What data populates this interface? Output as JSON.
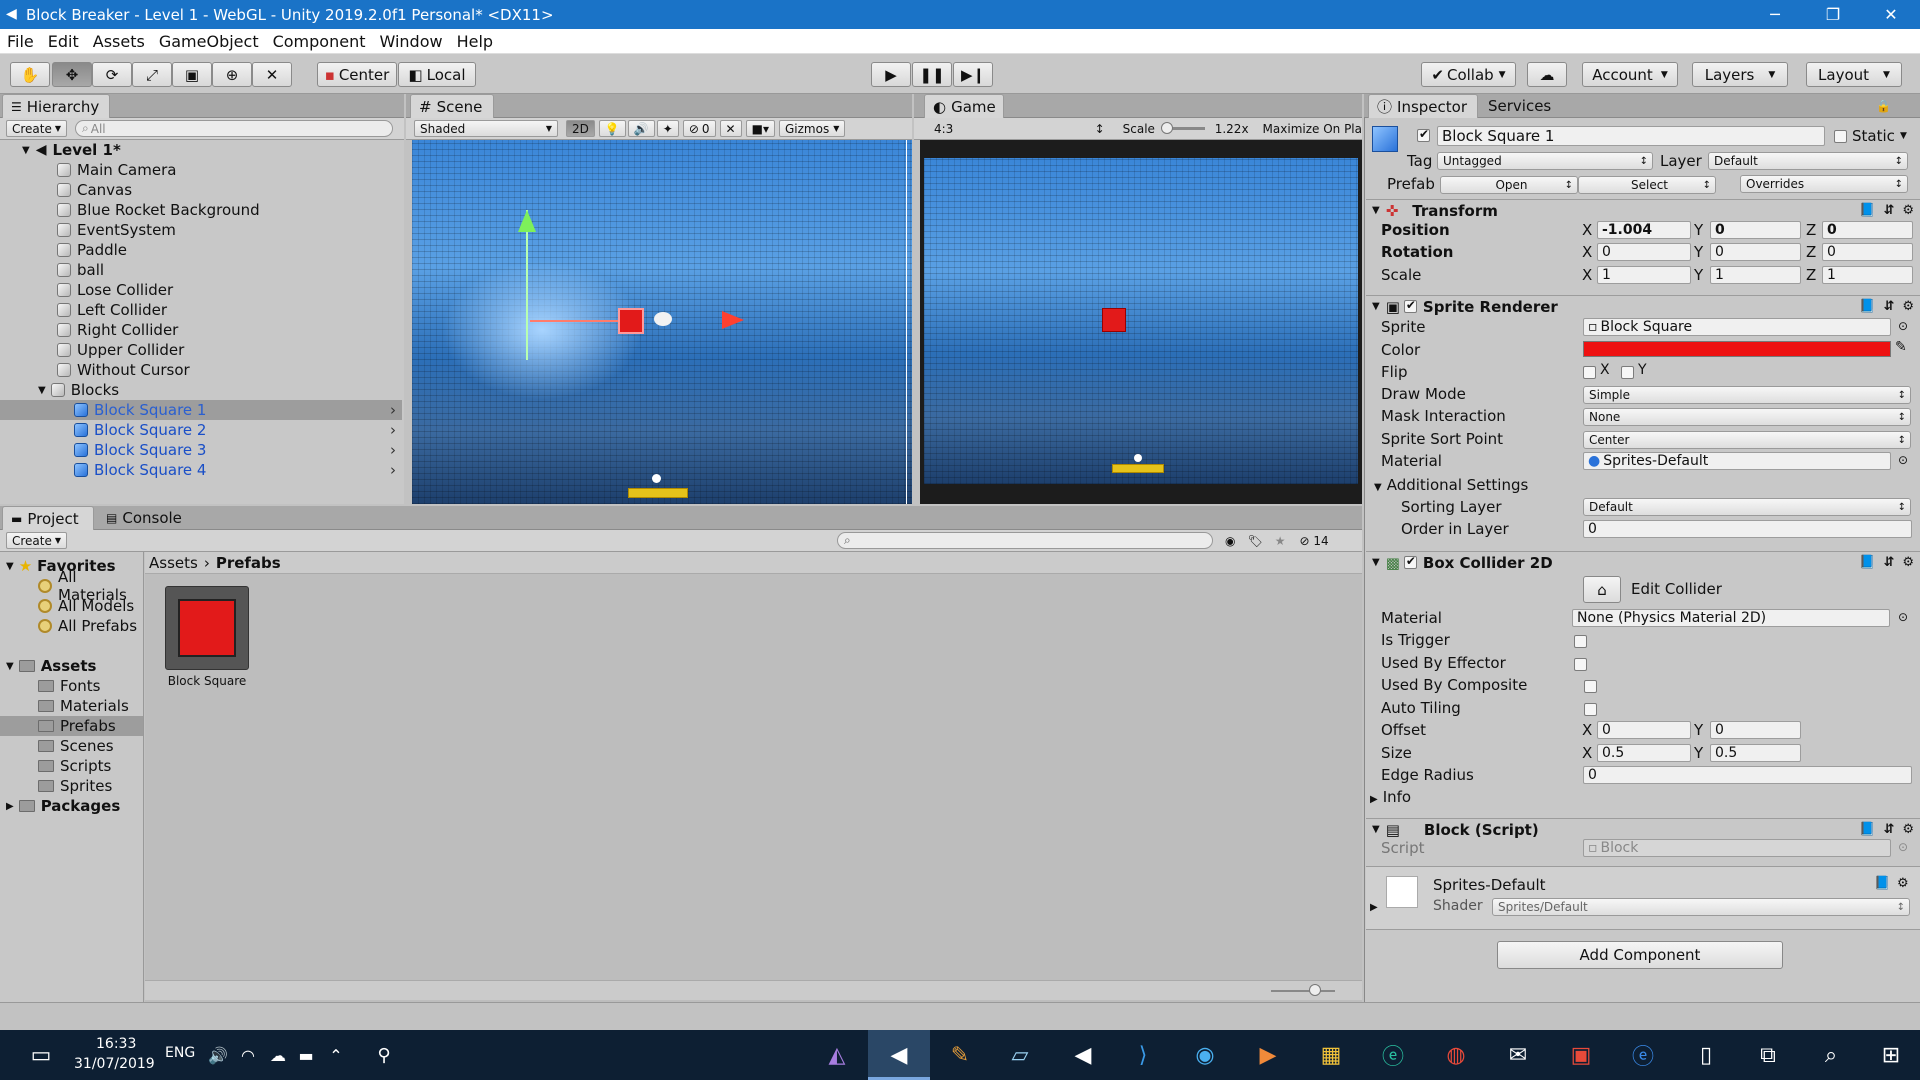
{
  "window": {
    "title": "Block Breaker - Level 1 - WebGL - Unity 2019.2.0f1 Personal* <DX11>",
    "minimize": "─",
    "restore": "❐",
    "close": "✕"
  },
  "menu": [
    "File",
    "Edit",
    "Assets",
    "GameObject",
    "Component",
    "Window",
    "Help"
  ],
  "toolbar": {
    "pivot": "Center",
    "space": "Local",
    "collab": "Collab",
    "account": "Account",
    "layers": "Layers",
    "layout": "Layout"
  },
  "hierarchy": {
    "tab": "Hierarchy",
    "create": "Create",
    "search_placeholder": "All",
    "scene": "Level 1*",
    "items": [
      "Main Camera",
      "Canvas",
      "Blue Rocket Background",
      "EventSystem",
      "Paddle",
      "ball",
      "Lose Collider",
      "Left Collider",
      "Right Collider",
      "Upper Collider",
      "Without Cursor",
      "Blocks"
    ],
    "blocks": [
      "Block Square 1",
      "Block Square 2",
      "Block Square 3",
      "Block Square 4"
    ]
  },
  "scene_view": {
    "tab": "Scene",
    "shading": "Shaded",
    "mode2d": "2D",
    "hidden_count": "0",
    "gizmos": "Gizmos"
  },
  "game_view": {
    "tab": "Game",
    "aspect": "4:3",
    "scale_label": "Scale",
    "scale_value": "1.22x",
    "maximize": "Maximize On Pla"
  },
  "project": {
    "tab": "Project",
    "console_tab": "Console",
    "create": "Create",
    "favorites": "Favorites",
    "fav_items": [
      "All Materials",
      "All Models",
      "All Prefabs"
    ],
    "assets": "Assets",
    "asset_folders": [
      "Fonts",
      "Materials",
      "Prefabs",
      "Scenes",
      "Scripts",
      "Sprites"
    ],
    "packages": "Packages",
    "breadcrumb_root": "Assets",
    "breadcrumb_current": "Prefabs",
    "asset_item": "Block Square",
    "hidden_count": "14"
  },
  "inspector": {
    "tab": "Inspector",
    "services_tab": "Services",
    "object_name": "Block Square 1",
    "static": "Static",
    "tag_label": "Tag",
    "tag": "Untagged",
    "layer_label": "Layer",
    "layer": "Default",
    "prefab_label": "Prefab",
    "open": "Open",
    "select": "Select",
    "overrides": "Overrides",
    "transform": {
      "title": "Transform",
      "position_label": "Position",
      "position": [
        "-1.004",
        "0",
        "0"
      ],
      "rotation_label": "Rotation",
      "rotation": [
        "0",
        "0",
        "0"
      ],
      "scale_label": "Scale",
      "scale": [
        "1",
        "1",
        "1"
      ]
    },
    "sprite_renderer": {
      "title": "Sprite Renderer",
      "sprite_label": "Sprite",
      "sprite": "Block Square",
      "color_label": "Color",
      "color": "#ee1111",
      "flip_label": "Flip",
      "draw_mode_label": "Draw Mode",
      "draw_mode": "Simple",
      "mask_label": "Mask Interaction",
      "mask": "None",
      "sort_point_label": "Sprite Sort Point",
      "sort_point": "Center",
      "material_label": "Material",
      "material": "Sprites-Default",
      "additional_settings": "Additional Settings",
      "sorting_layer_label": "Sorting Layer",
      "sorting_layer": "Default",
      "order_label": "Order in Layer",
      "order": "0"
    },
    "box_collider": {
      "title": "Box Collider 2D",
      "edit_collider": "Edit Collider",
      "material_label": "Material",
      "material": "None (Physics Material 2D)",
      "is_trigger": "Is Trigger",
      "used_by_effector": "Used By Effector",
      "used_by_composite": "Used By Composite",
      "auto_tiling": "Auto Tiling",
      "offset_label": "Offset",
      "offset": [
        "0",
        "0"
      ],
      "size_label": "Size",
      "size": [
        "0.5",
        "0.5"
      ],
      "edge_radius_label": "Edge Radius",
      "edge_radius": "0",
      "info": "Info"
    },
    "block_script": {
      "title": "Block (Script)",
      "script_label": "Script",
      "script": "Block"
    },
    "material_preview": {
      "name": "Sprites-Default",
      "shader_label": "Shader",
      "shader": "Sprites/Default"
    },
    "add_component": "Add Component"
  },
  "taskbar": {
    "time": "16:33",
    "date": "31/07/2019",
    "lang": "ENG"
  }
}
